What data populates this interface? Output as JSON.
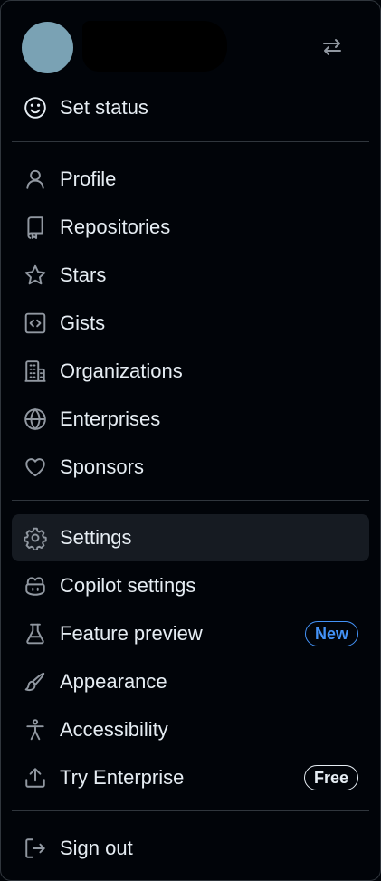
{
  "user": {
    "avatar_color": "#7aa2b4"
  },
  "header": {
    "switch_icon": "arrow-switch-icon"
  },
  "status": {
    "label": "Set status",
    "icon": "smiley-icon"
  },
  "nav_primary": [
    {
      "label": "Profile",
      "icon": "person-icon"
    },
    {
      "label": "Repositories",
      "icon": "repo-icon"
    },
    {
      "label": "Stars",
      "icon": "star-icon"
    },
    {
      "label": "Gists",
      "icon": "code-square-icon"
    },
    {
      "label": "Organizations",
      "icon": "organization-icon"
    },
    {
      "label": "Enterprises",
      "icon": "globe-icon"
    },
    {
      "label": "Sponsors",
      "icon": "heart-icon"
    }
  ],
  "nav_settings": [
    {
      "label": "Settings",
      "icon": "gear-icon",
      "active": true
    },
    {
      "label": "Copilot settings",
      "icon": "copilot-icon"
    },
    {
      "label": "Feature preview",
      "icon": "beaker-icon",
      "badge": "New"
    },
    {
      "label": "Appearance",
      "icon": "paintbrush-icon"
    },
    {
      "label": "Accessibility",
      "icon": "accessibility-icon"
    },
    {
      "label": "Try Enterprise",
      "icon": "upload-icon",
      "badge": "Free"
    }
  ],
  "footer": {
    "label": "Sign out",
    "icon": "sign-out-icon"
  },
  "colors": {
    "background": "#010409",
    "text": "#e6edf3",
    "icon": "#9198a1",
    "divider": "#30363d",
    "active_row": "#161b22",
    "accent_new": "#4493f8"
  }
}
